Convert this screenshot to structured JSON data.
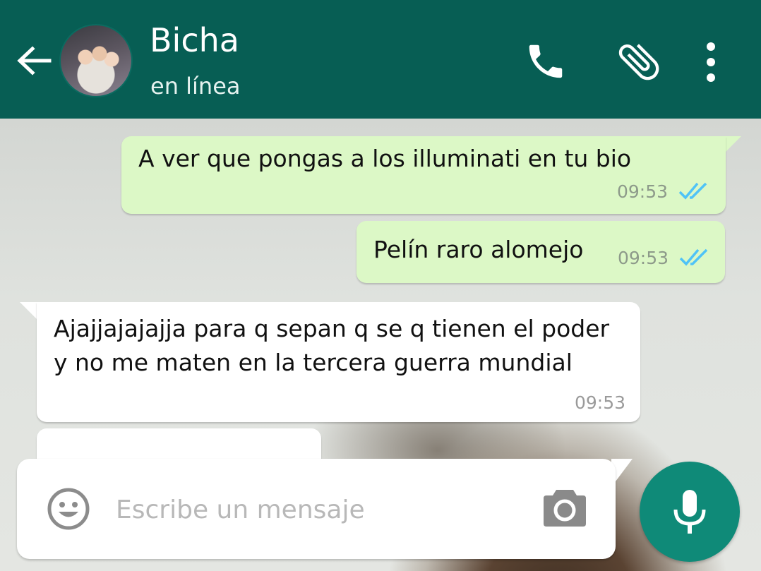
{
  "header": {
    "contact_name": "Bicha",
    "status": "en línea",
    "colors": {
      "bar": "#075e54"
    }
  },
  "messages": [
    {
      "direction": "outgoing",
      "text": "A ver que pongas a los illuminati en tu bio",
      "time": "09:53",
      "status_icon": "double-check-read-icon"
    },
    {
      "direction": "outgoing",
      "text": "Pelín raro alomejo",
      "time": "09:53",
      "status_icon": "double-check-read-icon"
    },
    {
      "direction": "incoming",
      "text": "Ajajjajajajja para q sepan q se q tienen el poder y no me maten en la tercera guerra mundial",
      "time": "09:53"
    }
  ],
  "composer": {
    "placeholder": "Escribe un mensaje"
  },
  "colors": {
    "outgoing_bubble": "#dcf8c6",
    "incoming_bubble": "#ffffff",
    "read_ticks": "#4fc3f7",
    "accent": "#0f8a78"
  },
  "icons": [
    "back-arrow-icon",
    "avatar",
    "phone-icon",
    "paperclip-icon",
    "more-vert-icon",
    "emoji-icon",
    "camera-icon",
    "mic-icon"
  ]
}
